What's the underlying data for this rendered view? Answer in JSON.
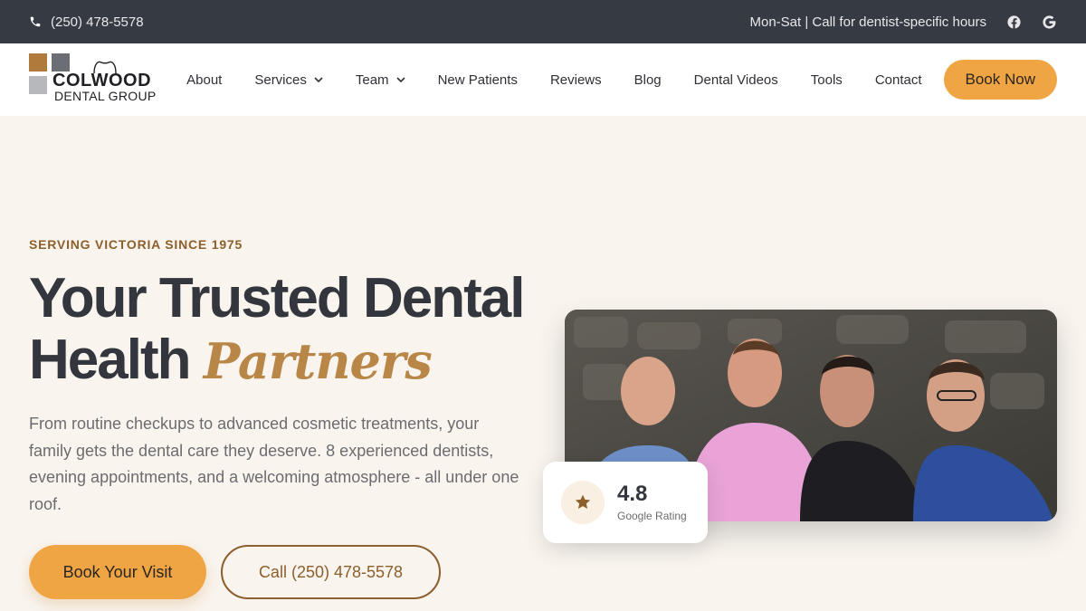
{
  "topbar": {
    "phone": "(250) 478-5578",
    "hours": "Mon-Sat | Call for dentist-specific hours",
    "social": [
      "facebook-icon",
      "google-icon"
    ]
  },
  "logo": {
    "line1": "COLWOOD",
    "line2": "DENTAL GROUP",
    "colors": [
      "#b07a3c",
      "#6b6e74",
      "#b7b8bc",
      "#ffffff"
    ]
  },
  "nav": {
    "items": [
      {
        "label": "About",
        "dropdown": false
      },
      {
        "label": "Services",
        "dropdown": true
      },
      {
        "label": "Team",
        "dropdown": true
      },
      {
        "label": "New Patients",
        "dropdown": false
      },
      {
        "label": "Reviews",
        "dropdown": false
      },
      {
        "label": "Blog",
        "dropdown": false
      },
      {
        "label": "Dental Videos",
        "dropdown": false
      },
      {
        "label": "Tools",
        "dropdown": false
      },
      {
        "label": "Contact",
        "dropdown": false
      }
    ],
    "cta": "Book Now"
  },
  "hero": {
    "kicker": "SERVING VICTORIA SINCE 1975",
    "headline_part1": "Your Trusted Dental",
    "headline_part2": "Health",
    "headline_accent": "Partners",
    "lede": "From routine checkups to advanced cosmetic treatments, your family gets the dental care they deserve. 8 experienced dentists, evening appointments, and a welcoming atmosphere - all under one roof.",
    "primary_cta": "Book Your Visit",
    "secondary_cta": "Call (250) 478-5578"
  },
  "rating": {
    "value": "4.8",
    "label": "Google Rating"
  },
  "colors": {
    "topbar": "#363a43",
    "accent": "#f0a545",
    "brown": "#8c5f2c",
    "hero_bg": "#f9f4ee"
  }
}
